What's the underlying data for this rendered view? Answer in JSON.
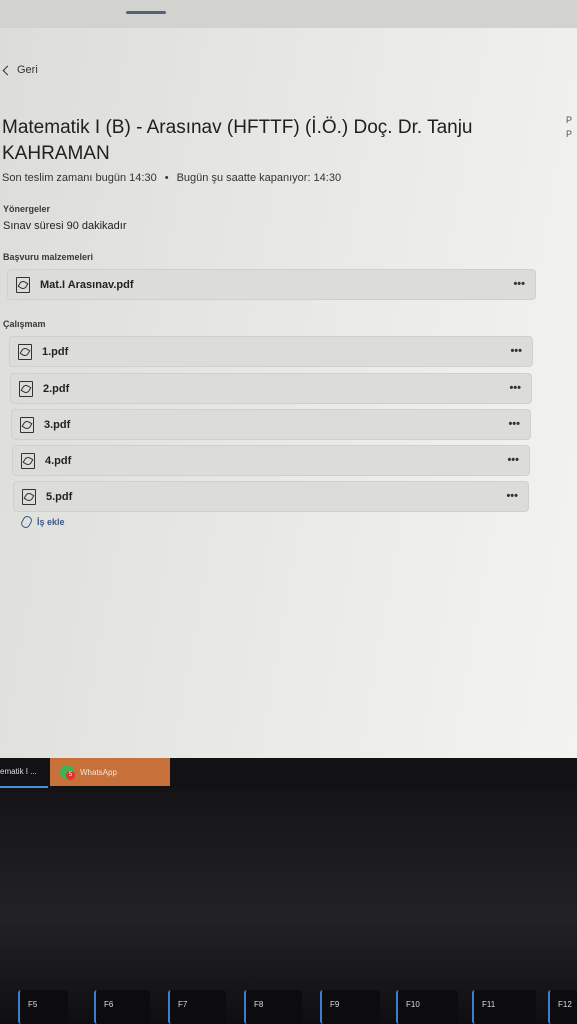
{
  "back_label": "Geri",
  "assignment": {
    "title": "Matematik I (B) - Arasınav (HFTTF) (İ.Ö.) Doç. Dr. Tanju KAHRAMAN",
    "due": "Son teslim zamanı bugün 14:30",
    "separator": "•",
    "closes": "Bugün şu saatte kapanıyor: 14:30",
    "instructions_label": "Yönergeler",
    "instructions": "Sınav süresi 90 dakikadır",
    "reference_label": "Başvuru malzemeleri",
    "reference_files": [
      {
        "name": "Mat.I Arasınav.pdf"
      }
    ],
    "work_label": "Çalışmam",
    "work_files": [
      {
        "name": "1.pdf"
      },
      {
        "name": "2.pdf"
      },
      {
        "name": "3.pdf"
      },
      {
        "name": "4.pdf"
      },
      {
        "name": "5.pdf"
      }
    ],
    "more_label": "•••",
    "add_work_label": "İş ekle"
  },
  "right_edge_letters": [
    "P",
    "P"
  ],
  "taskbar": {
    "item1": "ematik I ...",
    "item2": "WhatsApp",
    "whatsapp_badge": "5"
  },
  "keys": [
    "F5",
    "F6",
    "F7",
    "F8",
    "F9",
    "F10",
    "F11",
    "F12"
  ]
}
